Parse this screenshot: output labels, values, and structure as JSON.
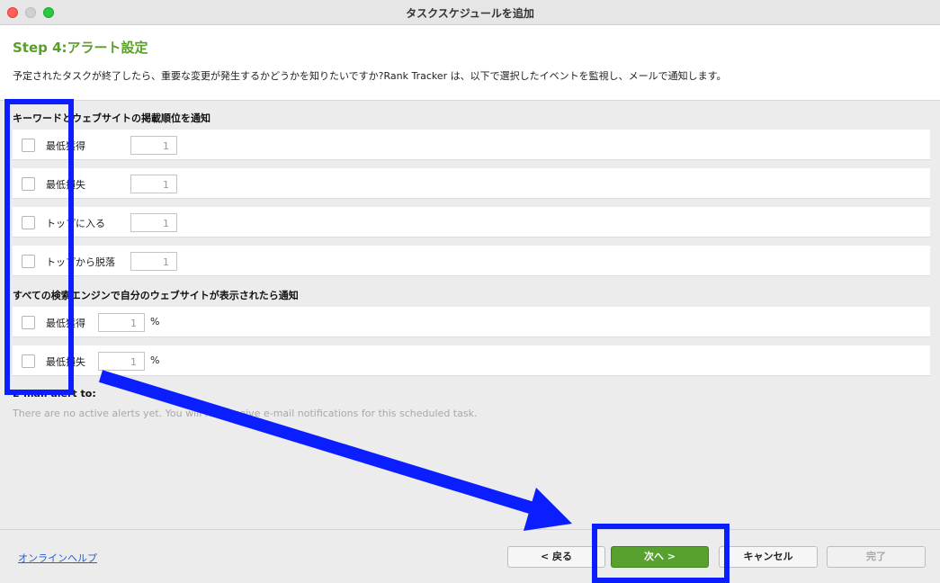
{
  "window": {
    "title": "タスクスケジュールを追加"
  },
  "header": {
    "step_title": "Step 4:アラート設定",
    "description": "予定されたタスクが終了したら、重要な変更が発生するかどうかを知りたいですか?Rank Tracker は、以下で選択したイベントを監視し、メールで通知します。"
  },
  "section1": {
    "title": "キーワードとウェブサイトの掲載順位を通知",
    "rows": [
      {
        "label": "最低獲得",
        "value": "1"
      },
      {
        "label": "最低損失",
        "value": "1"
      },
      {
        "label": "トップに入る",
        "value": "1"
      },
      {
        "label": "トップから脱落",
        "value": "1"
      }
    ]
  },
  "section2": {
    "title": "すべての検索エンジンで自分のウェブサイトが表示されたら通知",
    "rows": [
      {
        "label": "最低獲得",
        "value": "1",
        "unit": "%"
      },
      {
        "label": "最低損失",
        "value": "1",
        "unit": "%"
      }
    ]
  },
  "email": {
    "title": "E-mail alert to:",
    "note": "There are no active alerts yet. You will not receive e-mail notifications for this scheduled task."
  },
  "footer": {
    "help_label": "オンラインヘルプ",
    "back_label": "< 戻る",
    "next_label": "次へ >",
    "cancel_label": "キャンセル",
    "finish_label": "完了"
  },
  "colors": {
    "accent_green": "#5a9e2a",
    "next_button": "#57a22e",
    "annotation_blue": "#0a1eff"
  }
}
